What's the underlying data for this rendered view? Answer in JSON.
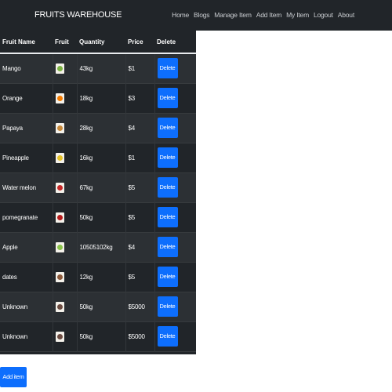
{
  "navbar": {
    "brand": "FRUITS WAREHOUSE",
    "links": [
      "Home",
      "Blogs",
      "Manage Item",
      "Add Item",
      "My Item",
      "Logout",
      "About"
    ]
  },
  "table": {
    "headers": [
      "Fruit Name",
      "Fruit",
      "Quantity",
      "Price",
      "Delete"
    ],
    "rows": [
      {
        "name": "Mango",
        "icon": "mango-image",
        "quantity": "43kg",
        "price": "$1",
        "action": "Delete",
        "color": "#7cb342"
      },
      {
        "name": "Orange",
        "icon": "orange-image",
        "quantity": "18kg",
        "price": "$3",
        "action": "Delete",
        "color": "#f57c00"
      },
      {
        "name": "Papaya",
        "icon": "papaya-image",
        "quantity": "28kg",
        "price": "$4",
        "action": "Delete",
        "color": "#c8893a"
      },
      {
        "name": "Pineapple",
        "icon": "pineapple-image",
        "quantity": "16kg",
        "price": "$1",
        "action": "Delete",
        "color": "#e6c229"
      },
      {
        "name": "Water melon",
        "icon": "watermelon-image",
        "quantity": "67kg",
        "price": "$5",
        "action": "Delete",
        "color": "#c62828"
      },
      {
        "name": "pomegranate",
        "icon": "pomegranate-image",
        "quantity": "50kg",
        "price": "$5",
        "action": "Delete",
        "color": "#b71c1c"
      },
      {
        "name": "Apple",
        "icon": "apple-image",
        "quantity": "10505102kg",
        "price": "$4",
        "action": "Delete",
        "color": "#8bc34a"
      },
      {
        "name": "dates",
        "icon": "dates-image",
        "quantity": "12kg",
        "price": "$5",
        "action": "Delete",
        "color": "#8d5a3b"
      },
      {
        "name": "Unknown",
        "icon": "broken-image",
        "quantity": "50kg",
        "price": "$5000",
        "action": "Delete",
        "color": "#6d4c41"
      },
      {
        "name": "Unknown",
        "icon": "broken-image",
        "quantity": "50kg",
        "price": "$5000",
        "action": "Delete",
        "color": "#6d4c41"
      }
    ]
  },
  "add_button": "Add item",
  "colors": {
    "navbar_bg": "#212529",
    "table_bg": "#212529",
    "table_stripe": "#2c3034",
    "button_primary": "#0d6efd"
  }
}
